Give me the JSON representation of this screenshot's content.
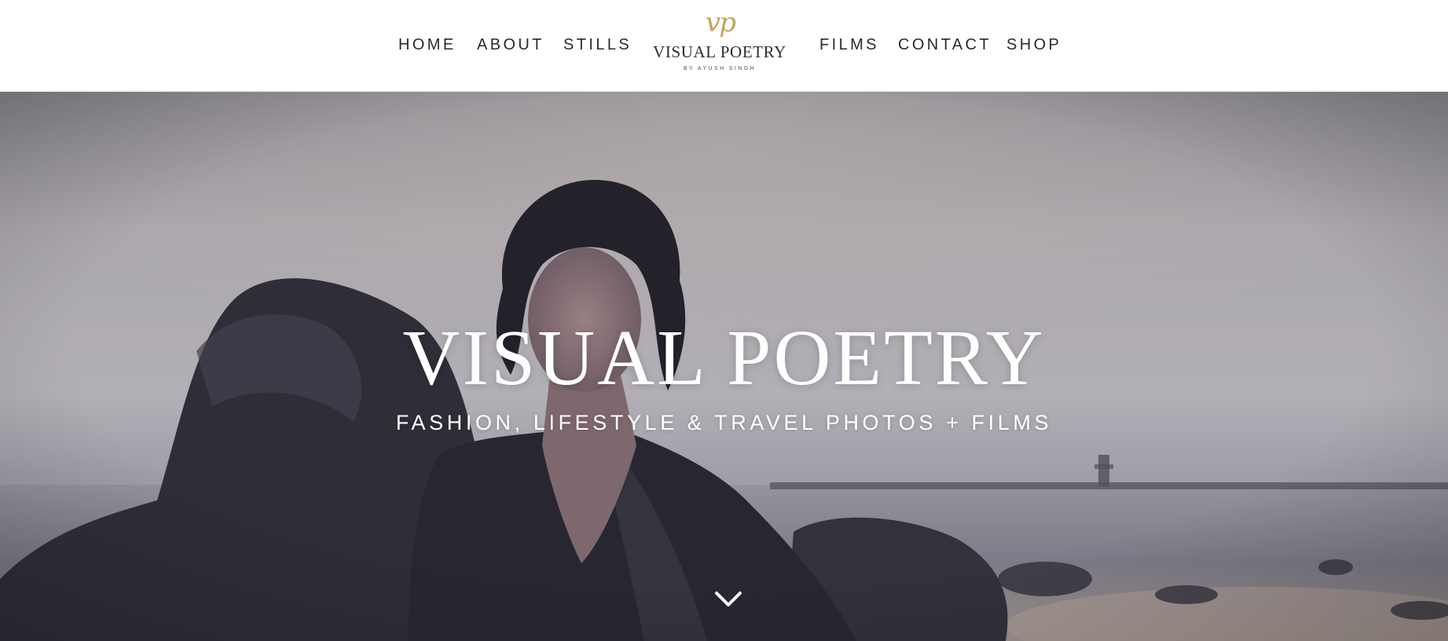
{
  "nav": {
    "left": [
      "HOME",
      "ABOUT",
      "STILLS"
    ],
    "right": [
      "FILMS",
      "CONTACT",
      "SHOP"
    ]
  },
  "logo": {
    "monogram": "vp",
    "name": "VISUAL POETRY",
    "byline": "BY AYUSH SINGH",
    "accent_color": "#c9a05a"
  },
  "hero": {
    "title": "VISUAL POETRY",
    "subtitle": "FASHION, LIFESTYLE & TRAVEL PHOTOS + FILMS",
    "scroll_icon": "chevron-down-icon"
  }
}
